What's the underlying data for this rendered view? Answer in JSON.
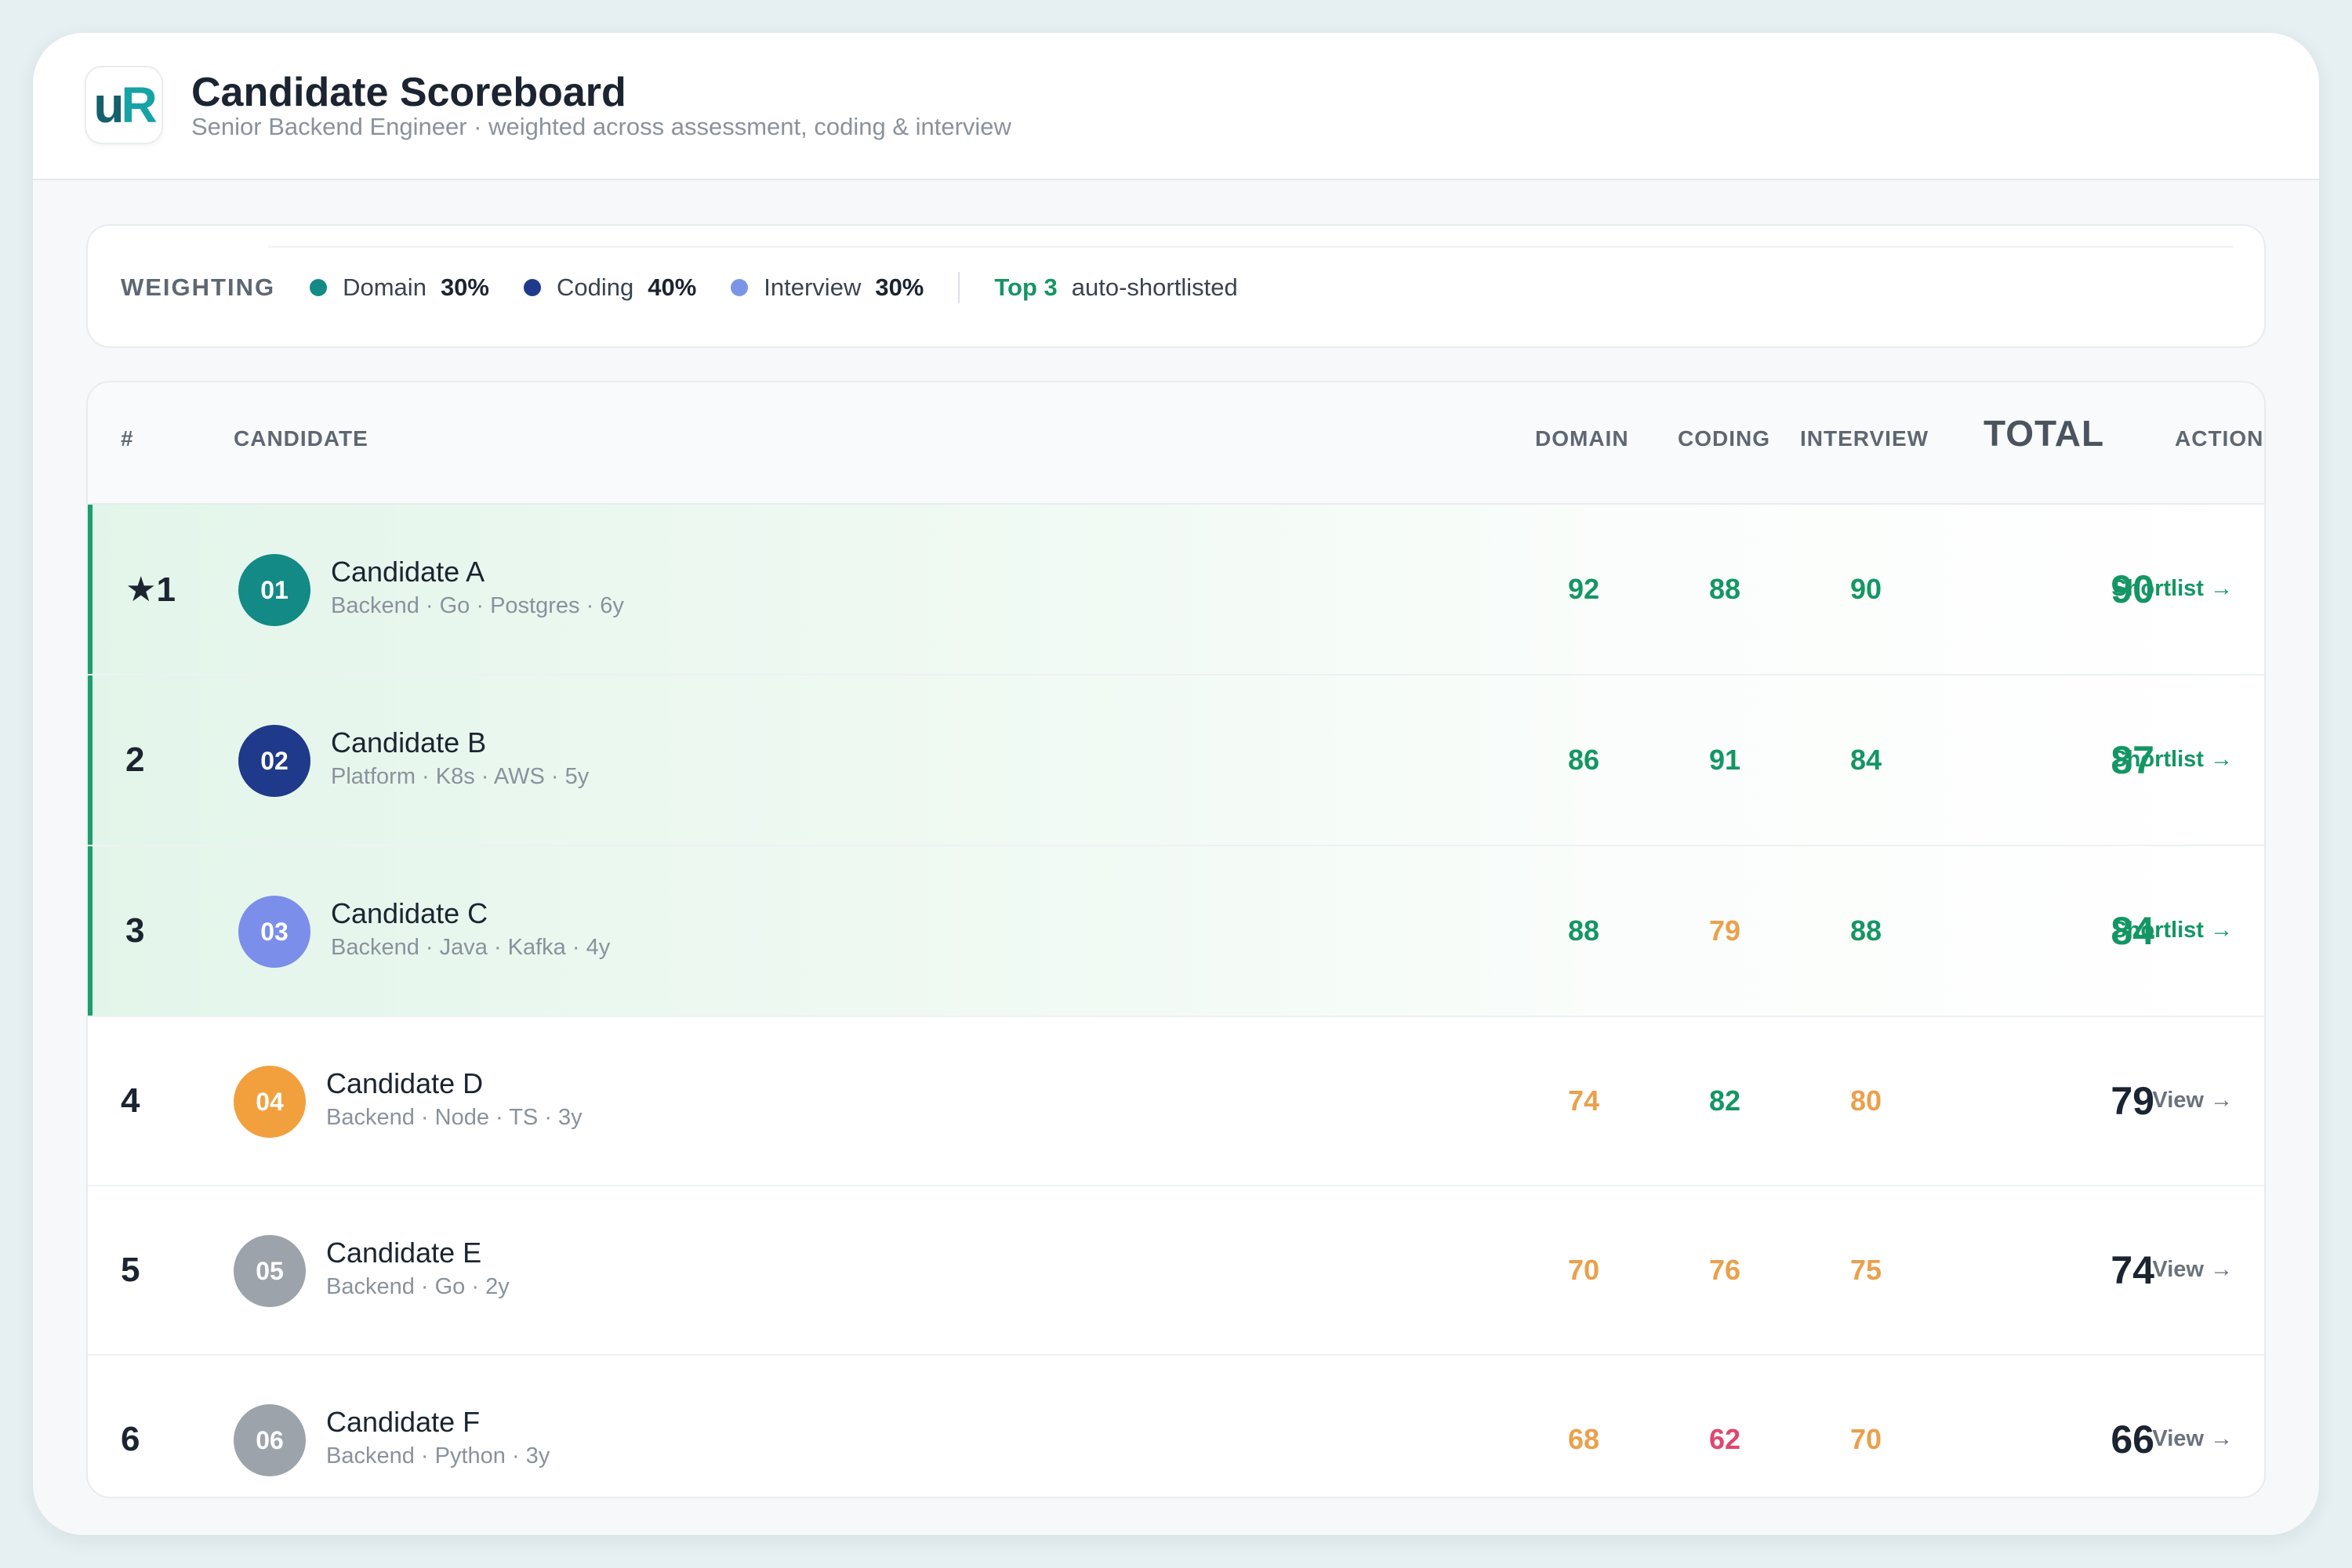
{
  "header": {
    "title": "Candidate Scoreboard",
    "subtitle": "Senior Backend Engineer · weighted across assessment, coding & interview",
    "logo_u": "u",
    "logo_r": "R"
  },
  "weighting": {
    "label": "WEIGHTING",
    "items": [
      {
        "name": "Domain",
        "pct": "30%",
        "color": "#138a85"
      },
      {
        "name": "Coding",
        "pct": "40%",
        "color": "#1f3a8a"
      },
      {
        "name": "Interview",
        "pct": "30%",
        "color": "#7b95e6"
      }
    ],
    "top_count": "Top 3",
    "top_text": "auto-shortlisted"
  },
  "table": {
    "headers": {
      "rank": "#",
      "candidate": "CANDIDATE",
      "domain": "DOMAIN",
      "coding": "CODING",
      "interview": "INTERVIEW",
      "total": "TOTAL",
      "action": "ACTION"
    },
    "rows": [
      {
        "rank": "★1",
        "badge": "01",
        "badge_color": "#138a85",
        "name": "Candidate A",
        "meta": "Backend · Go · Postgres · 6y",
        "domain": "92",
        "coding": "88",
        "interview": "90",
        "total": "90",
        "action": "Shortlist →",
        "shortlisted": true
      },
      {
        "rank": "2",
        "badge": "02",
        "badge_color": "#1f3a8a",
        "name": "Candidate B",
        "meta": "Platform · K8s · AWS · 5y",
        "domain": "86",
        "coding": "91",
        "interview": "84",
        "total": "87",
        "action": "Shortlist →",
        "shortlisted": true
      },
      {
        "rank": "3",
        "badge": "03",
        "badge_color": "#7b8ee9",
        "name": "Candidate C",
        "meta": "Backend · Java · Kafka · 4y",
        "domain": "88",
        "coding": "79",
        "interview": "88",
        "total": "84",
        "action": "Shortlist →",
        "shortlisted": true
      },
      {
        "rank": "4",
        "badge": "04",
        "badge_color": "#f2a03d",
        "name": "Candidate D",
        "meta": "Backend · Node · TS · 3y",
        "domain": "74",
        "coding": "82",
        "interview": "80",
        "total": "79",
        "action": "View →",
        "shortlisted": false
      },
      {
        "rank": "5",
        "badge": "05",
        "badge_color": "#9da3ab",
        "name": "Candidate E",
        "meta": "Backend · Go · 2y",
        "domain": "70",
        "coding": "76",
        "interview": "75",
        "total": "74",
        "action": "View →",
        "shortlisted": false
      },
      {
        "rank": "6",
        "badge": "06",
        "badge_color": "#9da3ab",
        "name": "Candidate F",
        "meta": "Backend · Python · 3y",
        "domain": "68",
        "coding": "62",
        "interview": "70",
        "total": "66",
        "action": "View →",
        "shortlisted": false
      }
    ]
  },
  "score_colors": {
    "high": "#149664",
    "mid": "#eba04b",
    "low": "#e0466e",
    "total_short": "#149664",
    "total_default": "#1b2430"
  }
}
